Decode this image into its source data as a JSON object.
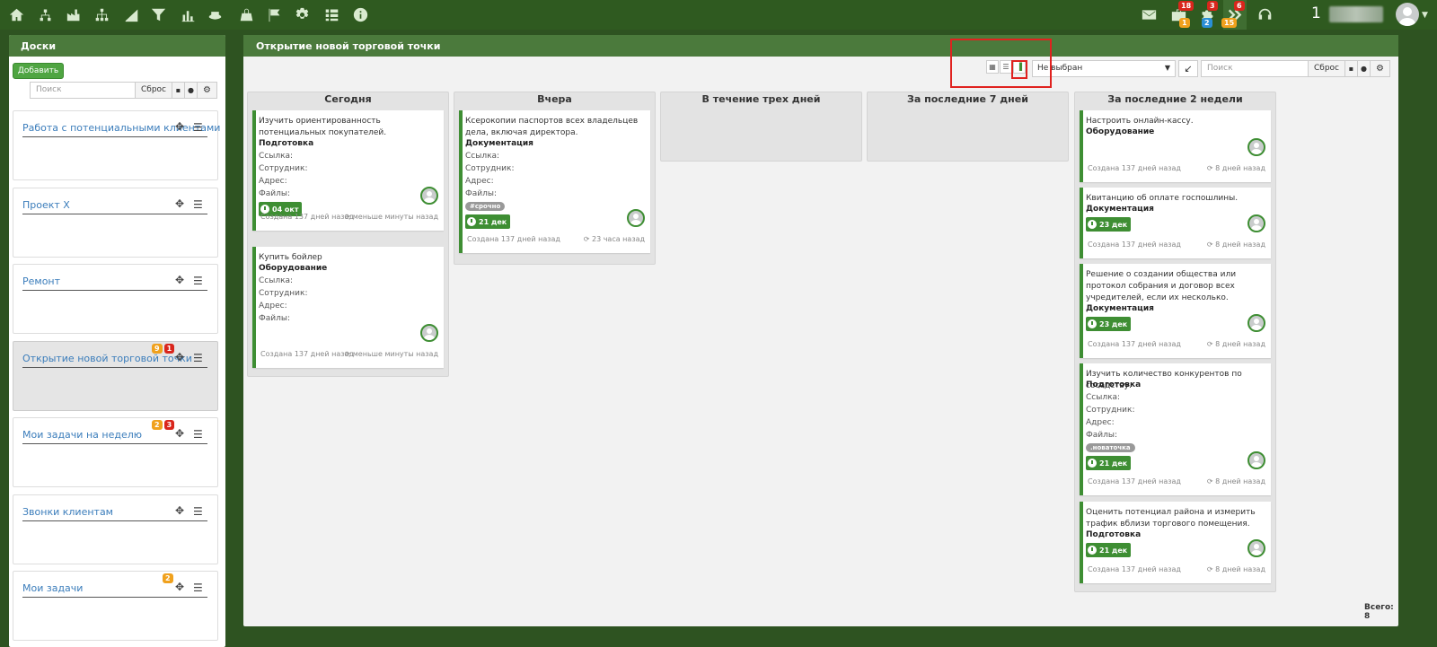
{
  "topbar": {
    "left_icons": [
      "home-icon",
      "sitemap-icon",
      "factory-icon",
      "hierarchy-icon",
      "chart-area-icon",
      "filter-icon",
      "bar-chart-icon",
      "hat-icon",
      "bag-icon",
      "flag-icon",
      "gear-icon",
      "list-icon",
      "info-icon"
    ],
    "right_icons": [
      {
        "name": "mail-icon",
        "badges": []
      },
      {
        "name": "briefcase-icon",
        "badges": [
          {
            "text": "18",
            "color": "red"
          },
          {
            "text": "1",
            "color": "orange"
          }
        ]
      },
      {
        "name": "puzzle-icon",
        "badges": [
          {
            "text": "3",
            "color": "red"
          },
          {
            "text": "2",
            "color": "blue"
          }
        ]
      },
      {
        "name": "chevrons-icon",
        "badges": [
          {
            "text": "6",
            "color": "red"
          },
          {
            "text": "15",
            "color": "orange"
          }
        ]
      },
      {
        "name": "headset-icon",
        "badges": []
      }
    ],
    "user_number": "1"
  },
  "left_panel": {
    "title": "Доски",
    "add_label": "Добавить",
    "search_placeholder": "Поиск",
    "reset_label": "Сброс",
    "boards": [
      {
        "title": "Работа с потенциальными клиентами",
        "badges": [],
        "active": false
      },
      {
        "title": "Проект X",
        "badges": [],
        "active": false
      },
      {
        "title": "Ремонт",
        "badges": [],
        "active": false
      },
      {
        "title": "Открытие новой торговой точки",
        "badges": [
          {
            "text": "9",
            "color": "orange"
          },
          {
            "text": "1",
            "color": "red"
          }
        ],
        "active": true
      },
      {
        "title": "Мои задачи на неделю",
        "badges": [
          {
            "text": "2",
            "color": "orange"
          },
          {
            "text": "3",
            "color": "red"
          }
        ],
        "active": false
      },
      {
        "title": "Звонки клиентам",
        "badges": [],
        "active": false
      },
      {
        "title": "Мои задачи",
        "badges": [
          {
            "text": "2",
            "color": "orange"
          }
        ],
        "active": false
      }
    ]
  },
  "main": {
    "title": "Открытие новой торговой точки",
    "user_select": "Не выбран",
    "search_placeholder": "Поиск",
    "reset_label": "Сброс",
    "total_label": "Всего: 8",
    "columns": [
      {
        "title": "Сегодня",
        "tasks": [
          {
            "title": "Изучить ориентированность потенциальных покупателей.",
            "category": "Подготовка",
            "fields": [
              "Ссылка:",
              "Сотрудник:",
              "Адрес:",
              "Файлы:"
            ],
            "tag": "",
            "date": "04 окт",
            "created": "Создана 137 дней назад",
            "updated": "меньше минуты назад"
          },
          {
            "title": "Купить бойлер",
            "category": "Оборудование",
            "fields": [
              "Ссылка:",
              "Сотрудник:",
              "Адрес:",
              "Файлы:"
            ],
            "tag": "",
            "date": "",
            "created": "Создана 137 дней назад",
            "updated": "меньше минуты назад"
          }
        ]
      },
      {
        "title": "Вчера",
        "tasks": [
          {
            "title": "Ксерокопии паспортов всех владельцев дела, включая директора.",
            "category": "Документация",
            "fields": [
              "Ссылка:",
              "Сотрудник:",
              "Адрес:",
              "Файлы:"
            ],
            "tag": "#срочно",
            "date": "21 дек",
            "created": "Создана 137 дней назад",
            "updated": "23 часа назад"
          }
        ]
      },
      {
        "title": "В течение трех дней",
        "tasks": []
      },
      {
        "title": "За последние 7 дней",
        "tasks": []
      },
      {
        "title": "За последние 2 недели",
        "tasks": [
          {
            "title": "Настроить онлайн-кассу.",
            "category": "Оборудование",
            "fields": [],
            "tag": "",
            "date": "",
            "created": "Создана 137 дней назад",
            "updated": "8 дней назад"
          },
          {
            "title": "Квитанцию об оплате госпошлины.",
            "category": "Документация",
            "fields": [],
            "tag": "",
            "date": "23 дек",
            "created": "Создана 137 дней назад",
            "updated": "8 дней назад"
          },
          {
            "title": "Решение о создании общества или протокол собрания и договор всех учредителей, если их несколько.",
            "category": "Документация",
            "fields": [],
            "tag": "",
            "date": "23 дек",
            "created": "Создана 137 дней назад",
            "updated": "8 дней назад"
          },
          {
            "title": "Изучить количество конкурентов по соседству.",
            "category": "Подготовка",
            "fields": [
              "Ссылка:",
              "Сотрудник:",
              "Адрес:",
              "Файлы:"
            ],
            "tag": ".новаточка",
            "date": "21 дек",
            "created": "Создана 137 дней назад",
            "updated": "8 дней назад"
          },
          {
            "title": "Оценить потенциал района и измерить трафик вблизи торгового помещения.",
            "category": "Подготовка",
            "fields": [],
            "tag": "",
            "date": "21 дек",
            "created": "Создана 137 дней назад",
            "updated": "8 дней назад"
          }
        ]
      }
    ]
  },
  "colors": {
    "topbar": "#2f5a20",
    "panel_head": "#4b7a3c",
    "accent_green": "#3e8e33",
    "link_blue": "#3b7dbb",
    "highlight_red": "#e0221f"
  }
}
